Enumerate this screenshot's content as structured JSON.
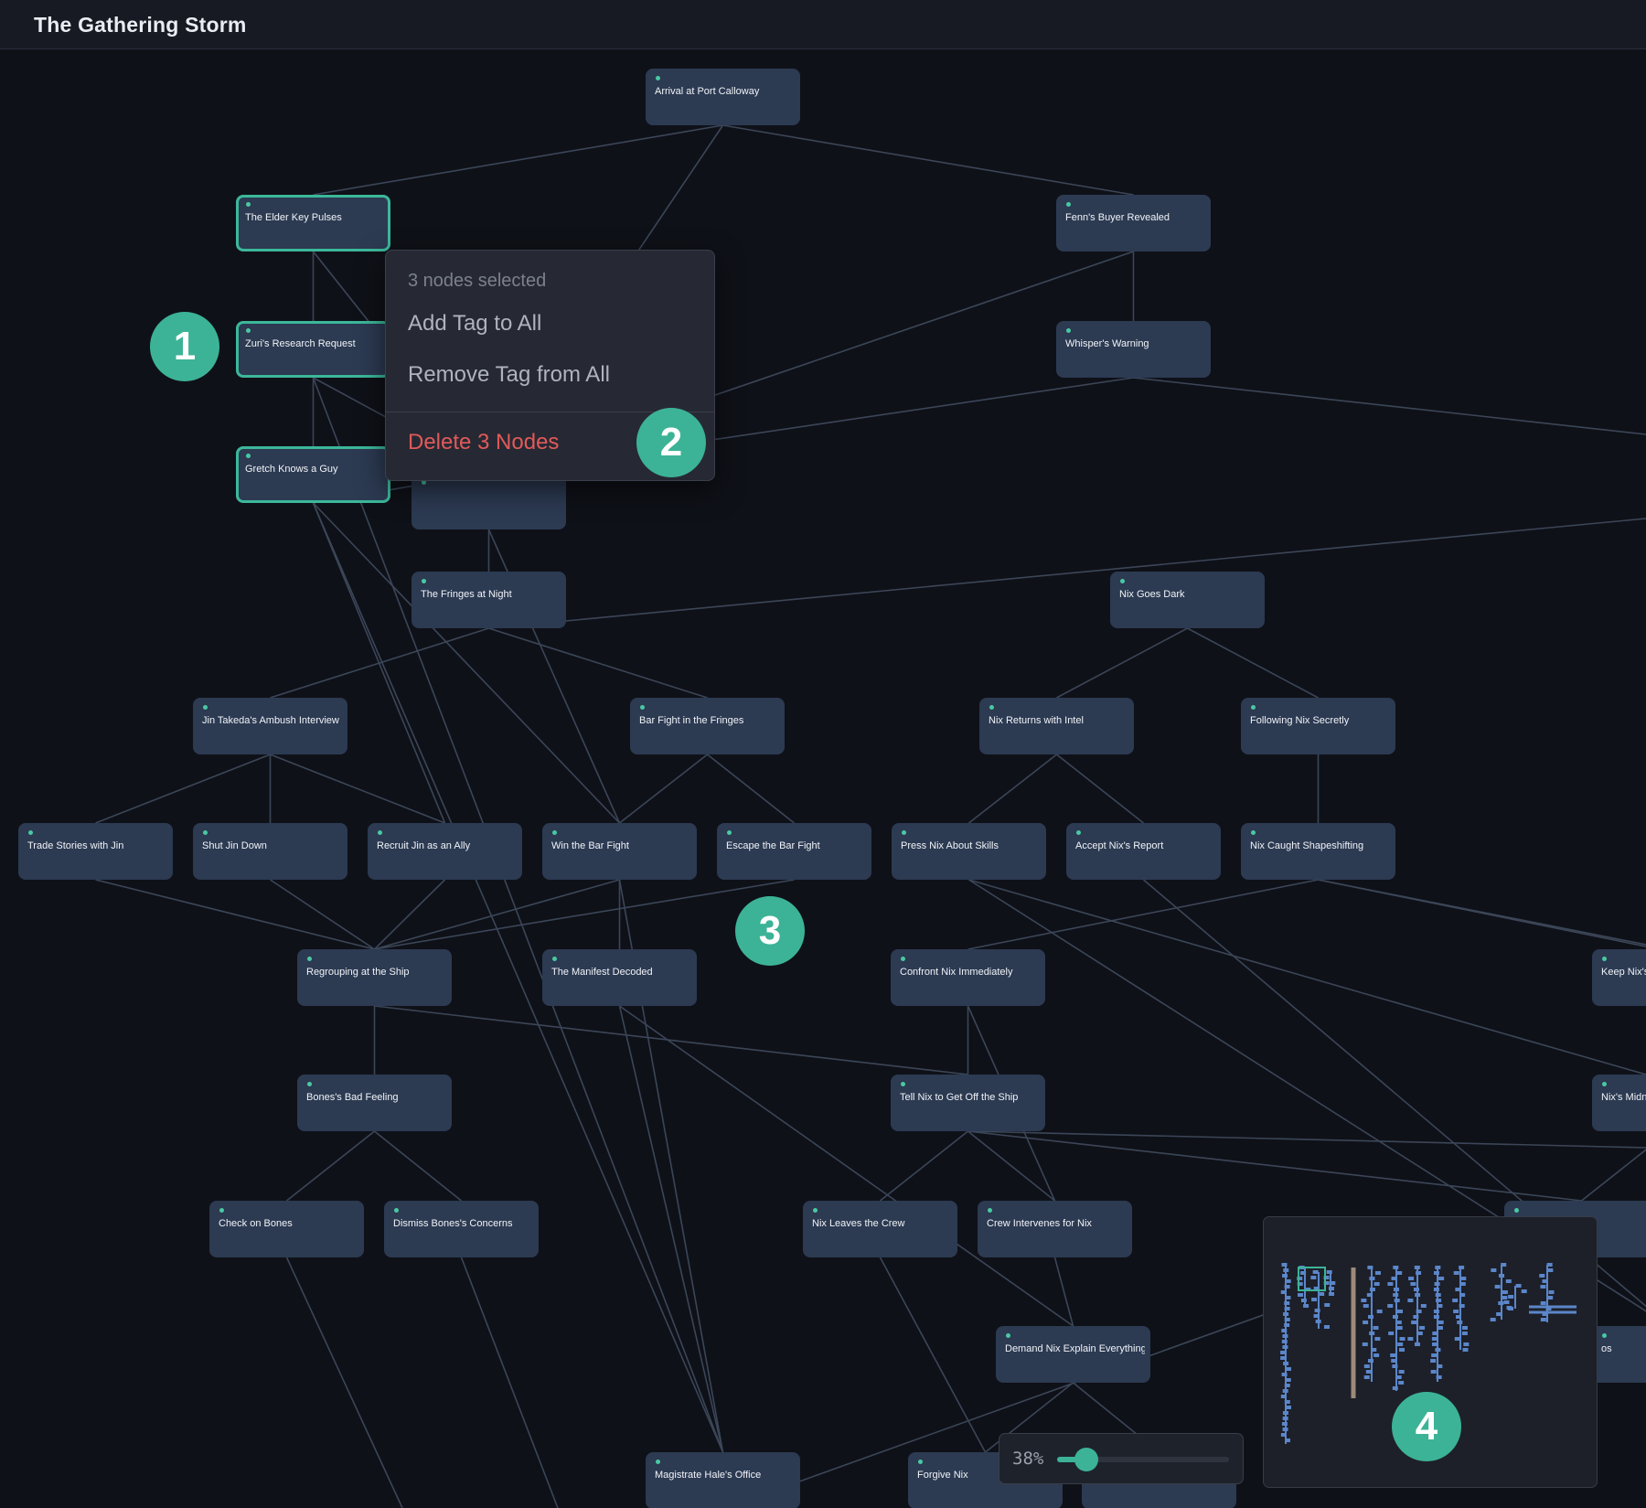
{
  "app": {
    "title": "The Gathering Storm"
  },
  "context_menu": {
    "header": "3 nodes selected",
    "add_tag": "Add Tag to All",
    "remove_tag": "Remove Tag from All",
    "delete": "Delete 3 Nodes"
  },
  "badges": [
    "1",
    "2",
    "3",
    "4"
  ],
  "zoom": {
    "label": "38%",
    "level": 0.17
  },
  "nodes": [
    "Arrival at Port Calloway",
    "The Elder Key Pulses",
    "Fenn's Buyer Revealed",
    "Zuri's Research Request",
    "Whisper's Warning",
    "Gretch Knows a Guy",
    "The Fringes at Night",
    "Nix Goes Dark",
    "Jin Takeda's Ambush Interview",
    "Bar Fight in the Fringes",
    "Nix Returns with Intel",
    "Following Nix Secretly",
    "Trade Stories with Jin",
    "Shut Jin Down",
    "Recruit Jin as an Ally",
    "Win the Bar Fight",
    "Escape the Bar Fight",
    "Press Nix About Skills",
    "Accept Nix's Report",
    "Nix Caught Shapeshifting",
    "Regrouping at the Ship",
    "The Manifest Decoded",
    "Confront Nix Immediately",
    "Keep Nix's",
    "Bones's Bad Feeling",
    "Tell Nix to Get Off the Ship",
    "Nix's Midni",
    "Check on Bones",
    "Dismiss Bones's Concerns",
    "Nix Leaves the Crew",
    "Crew Intervenes for Nix",
    "",
    "Demand Nix Explain Everything",
    "os",
    "Magistrate Hale's Office",
    "Forgive Nix",
    "",
    ""
  ],
  "colors": {
    "accent": "#3cb396",
    "danger": "#e05a5a",
    "node": "#2c3a52",
    "edge": "#3b4658"
  }
}
